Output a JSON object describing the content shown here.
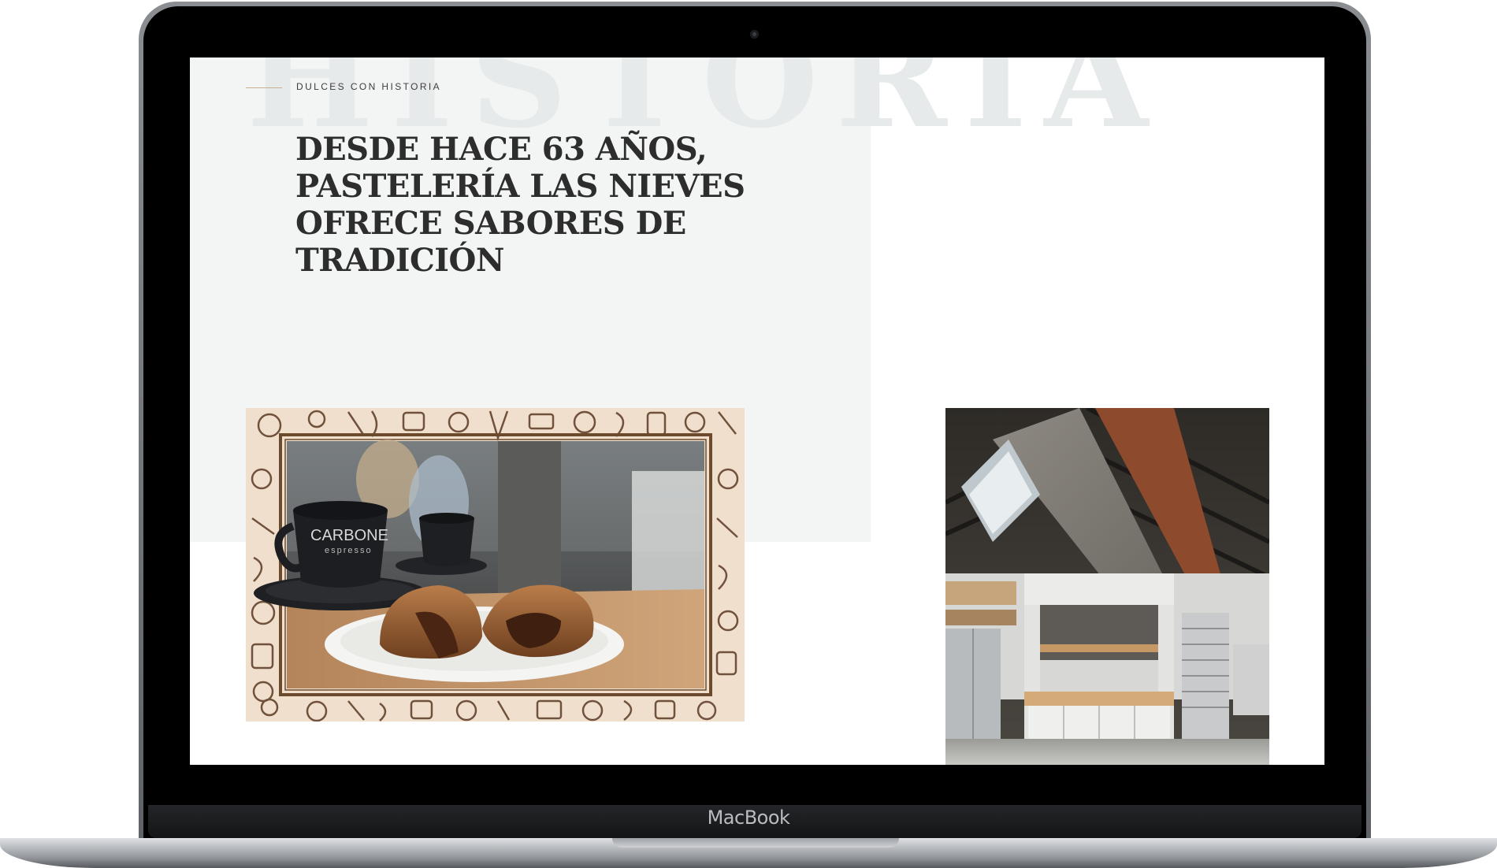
{
  "device": {
    "brand_label": "MacBook"
  },
  "page": {
    "watermark_text": "HISTORIA",
    "eyebrow": "DULCES CON HISTORIA",
    "headline": {
      "lines": [
        "DESDE HACE 63 AÑOS,",
        "PASTELERÍA LAS NIEVES",
        "OFRECE SABORES DE",
        "TRADICIÓN"
      ]
    },
    "gallery": {
      "coffee_photo": {
        "cup_brand": "CARBONE",
        "cup_sub": "espresso"
      }
    }
  },
  "colors": {
    "panel_bg": "#f3f5f5",
    "headline": "#2d2d2d",
    "accent_line": "#c7b08d",
    "watermark": "#e6eaea"
  }
}
